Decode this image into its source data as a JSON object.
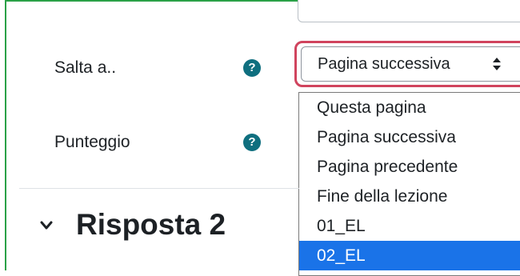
{
  "form": {
    "jump_label": "Salta a..",
    "score_label": "Punteggio",
    "help_glyph": "?",
    "jump_select_value": "Pagina successiva",
    "jump_options": [
      {
        "label": "Questa pagina",
        "selected": false
      },
      {
        "label": "Pagina successiva",
        "selected": false
      },
      {
        "label": "Pagina precedente",
        "selected": false
      },
      {
        "label": "Fine della lezione",
        "selected": false
      },
      {
        "label": "01_EL",
        "selected": false
      },
      {
        "label": "02_EL",
        "selected": true
      }
    ]
  },
  "section": {
    "title": "Risposta 2"
  },
  "colors": {
    "focus_ring": "#d0445e",
    "help_icon": "#0f6f7f",
    "highlight": "#1a73e8",
    "frame": "#2aa147"
  },
  "icons": {
    "help": "question-circle-icon",
    "select_arrows": "sort-arrows-icon",
    "collapse": "chevron-down-icon"
  }
}
